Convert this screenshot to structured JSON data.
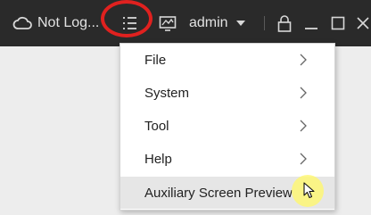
{
  "topbar": {
    "status_label": "Not Log...",
    "user_label": "admin",
    "icons": [
      "cloud-icon",
      "menu-list-icon",
      "monitor-icon",
      "caret-down-icon",
      "lock-icon",
      "minimize-icon",
      "maximize-icon",
      "close-icon"
    ]
  },
  "menu": {
    "items": [
      {
        "label": "File",
        "submenu": true
      },
      {
        "label": "System",
        "submenu": true
      },
      {
        "label": "Tool",
        "submenu": true
      },
      {
        "label": "Help",
        "submenu": true
      },
      {
        "label": "Auxiliary Screen Preview",
        "submenu": false,
        "highlighted": true
      }
    ]
  },
  "colors": {
    "topbar_bg": "#2a2a2a",
    "annotation_circle": "#e0211f",
    "cursor_highlight": "#fff86e",
    "menu_hover": "#e6e6e6"
  }
}
